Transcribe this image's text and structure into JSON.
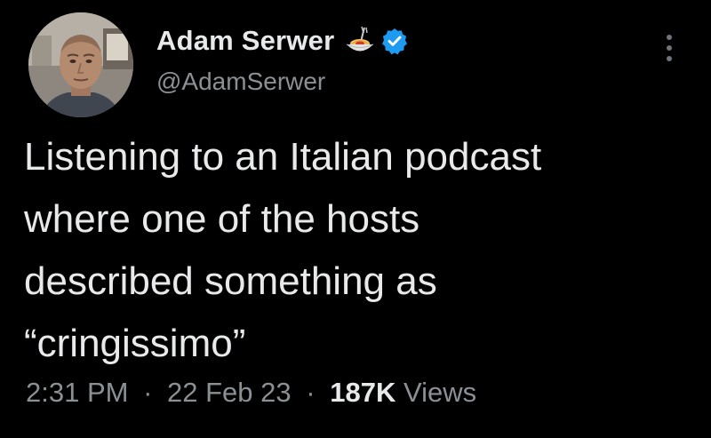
{
  "author": {
    "display_name": "Adam Serwer",
    "handle": "@AdamSerwer",
    "name_emoji": "spaghetti-emoji",
    "verified_icon": "verified-badge-icon",
    "verified_color": "#1d9bf0"
  },
  "tweet": {
    "text": "Listening to an Italian podcast\nwhere one of the hosts\ndescribed something as\n“cringissimo”"
  },
  "meta": {
    "time": "2:31 PM",
    "separator": "·",
    "date": "22 Feb 23",
    "views_count": "187K",
    "views_label": "Views"
  },
  "menu": {
    "icon": "more-vertical-icon"
  },
  "colors": {
    "background": "#000000",
    "primary_text": "#e7e9ea",
    "secondary_text": "#8b9095",
    "accent": "#1d9bf0"
  }
}
